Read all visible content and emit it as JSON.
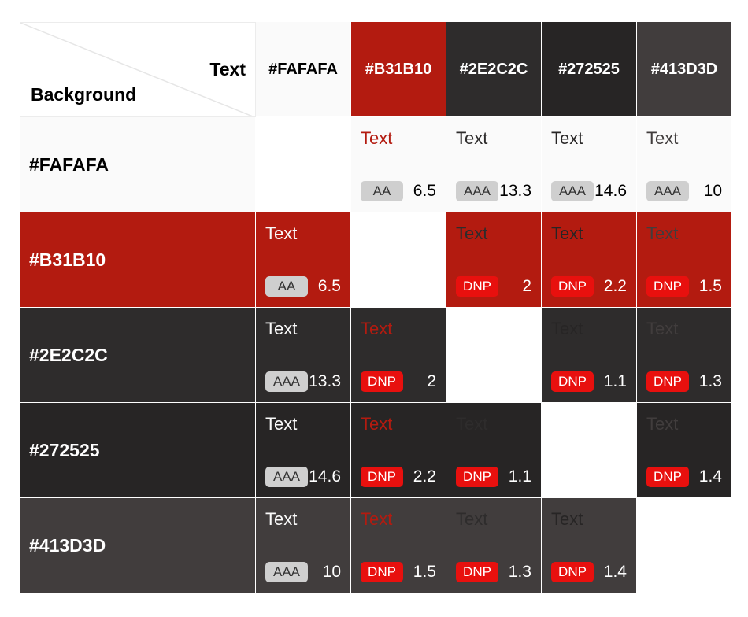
{
  "corner": {
    "text_label": "Text",
    "background_label": "Background"
  },
  "colors": [
    "#FAFAFA",
    "#B31B10",
    "#2E2C2C",
    "#272525",
    "#413D3D"
  ],
  "header_text_colors": [
    "#000000",
    "#FFFFFF",
    "#FFFFFF",
    "#FFFFFF",
    "#FFFFFF"
  ],
  "sample_text": "Text",
  "badge_styles": {
    "AA": {
      "bg": "#CFCFCF",
      "fg": "#333333"
    },
    "AAA": {
      "bg": "#CFCFCF",
      "fg": "#333333"
    },
    "DNP": {
      "bg": "#E8100E",
      "fg": "#FFFFFF"
    }
  },
  "rows": [
    {
      "label": "#FAFAFA",
      "cells": [
        null,
        {
          "rating": "AA",
          "ratio": "6.5"
        },
        {
          "rating": "AAA",
          "ratio": "13.3"
        },
        {
          "rating": "AAA",
          "ratio": "14.6"
        },
        {
          "rating": "AAA",
          "ratio": "10"
        }
      ]
    },
    {
      "label": "#B31B10",
      "cells": [
        {
          "rating": "AA",
          "ratio": "6.5"
        },
        null,
        {
          "rating": "DNP",
          "ratio": "2"
        },
        {
          "rating": "DNP",
          "ratio": "2.2"
        },
        {
          "rating": "DNP",
          "ratio": "1.5"
        }
      ]
    },
    {
      "label": "#2E2C2C",
      "cells": [
        {
          "rating": "AAA",
          "ratio": "13.3"
        },
        {
          "rating": "DNP",
          "ratio": "2"
        },
        null,
        {
          "rating": "DNP",
          "ratio": "1.1"
        },
        {
          "rating": "DNP",
          "ratio": "1.3"
        }
      ]
    },
    {
      "label": "#272525",
      "cells": [
        {
          "rating": "AAA",
          "ratio": "14.6"
        },
        {
          "rating": "DNP",
          "ratio": "2.2"
        },
        {
          "rating": "DNP",
          "ratio": "1.1"
        },
        null,
        {
          "rating": "DNP",
          "ratio": "1.4"
        }
      ]
    },
    {
      "label": "#413D3D",
      "cells": [
        {
          "rating": "AAA",
          "ratio": "10"
        },
        {
          "rating": "DNP",
          "ratio": "1.5"
        },
        {
          "rating": "DNP",
          "ratio": "1.3"
        },
        {
          "rating": "DNP",
          "ratio": "1.4"
        },
        null
      ]
    }
  ]
}
